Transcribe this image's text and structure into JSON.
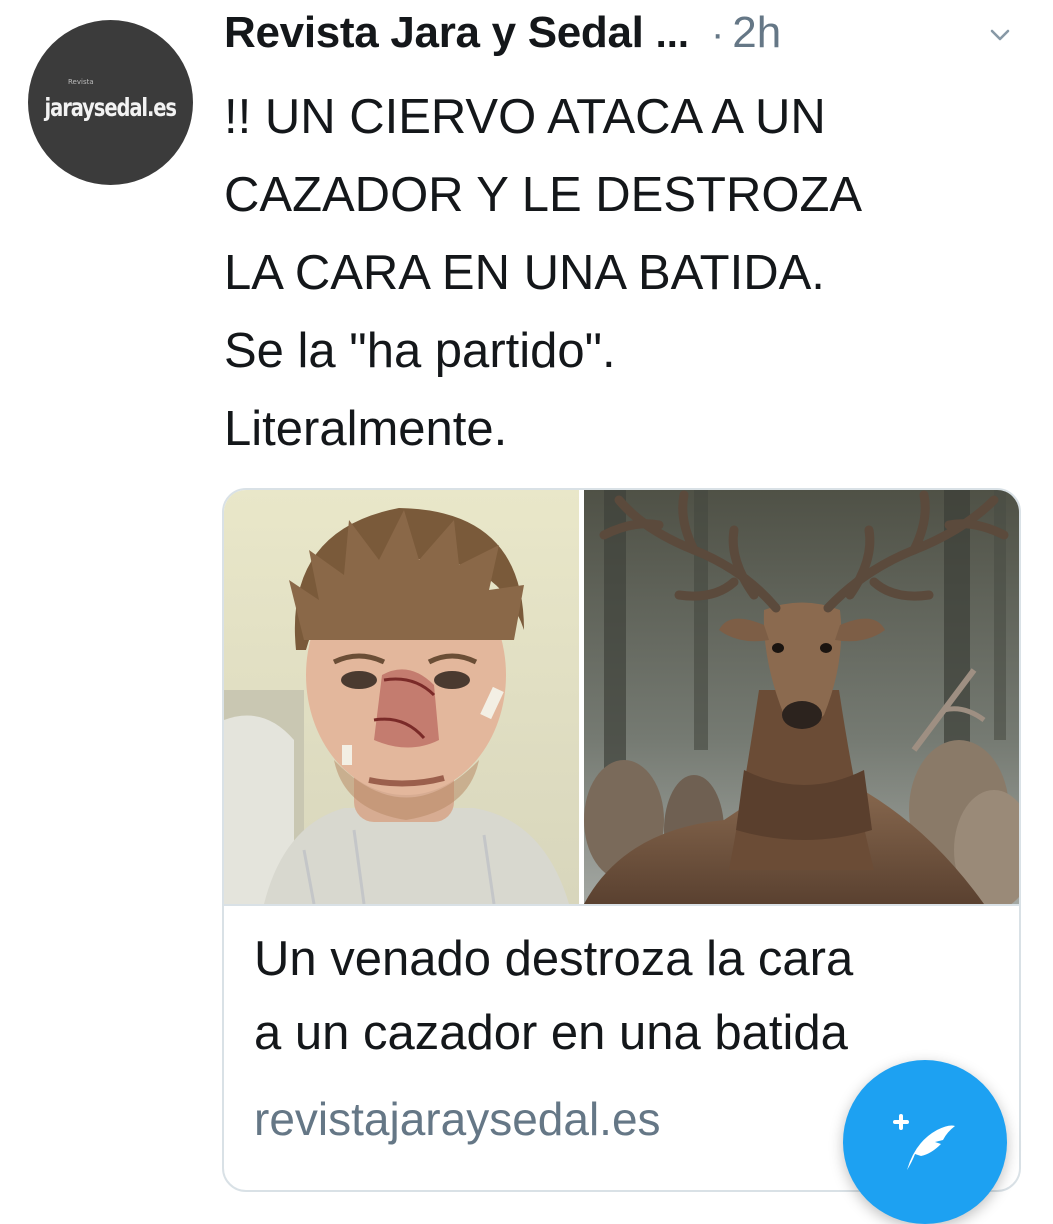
{
  "author": {
    "avatar_text": "jaraysedal.es",
    "avatar_small_text": "Revista",
    "name": "Revista Jara y Sedal",
    "ellipsis": "...",
    "separator": "·",
    "time": "2h"
  },
  "tweet": {
    "text": "!! UN CIERVO ATACA A UN\nCAZADOR Y LE DESTROZA\nLA CARA EN UNA BATIDA.\nSe la \"ha partido\".\nLiteralmente."
  },
  "card": {
    "title": "Un venado destroza la cara\na un cazador en una batida",
    "domain": "revistajaraysedal.es",
    "images": [
      "injured-hunter-photo",
      "red-deer-stag-photo"
    ]
  },
  "icons": {
    "menu": "chevron-down-icon",
    "compose": "compose-quill-icon"
  },
  "colors": {
    "accent": "#1da1f2",
    "muted": "#657786",
    "text": "#14171a",
    "border": "#d9e1e6"
  }
}
